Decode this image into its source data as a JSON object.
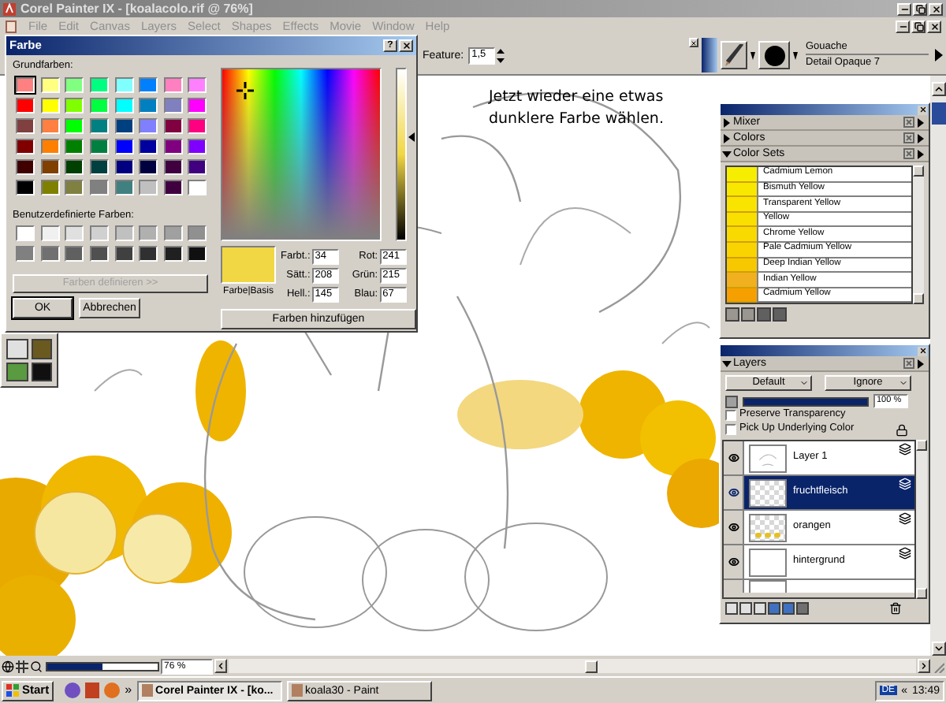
{
  "window": {
    "title": "Corel Painter IX - [koalacolo.rif @ 76%]"
  },
  "menu": [
    "File",
    "Edit",
    "Canvas",
    "Layers",
    "Select",
    "Shapes",
    "Effects",
    "Movie",
    "Window",
    "Help"
  ],
  "property_bar": {
    "feature_label": "Feature:",
    "feature_value": "1,5",
    "brush_category": "Gouache",
    "brush_variant": "Detail Opaque 7"
  },
  "canvas": {
    "caption": "Jetzt wieder eine etwas dunklere Farbe wählen."
  },
  "color_dialog": {
    "title": "Farbe",
    "help": "?",
    "basic_label": "Grundfarben:",
    "basic_colors": [
      {
        "color": "#ff8080",
        "selected": true
      },
      {
        "color": "#ffff80",
        "selected": false
      },
      {
        "color": "#80ff80",
        "selected": false
      },
      {
        "color": "#00ff80",
        "selected": false
      },
      {
        "color": "#80ffff",
        "selected": false
      },
      {
        "color": "#0080ff",
        "selected": false
      },
      {
        "color": "#ff80c0",
        "selected": false
      },
      {
        "color": "#ff80ff",
        "selected": false
      },
      {
        "color": "#ff0000",
        "selected": false
      },
      {
        "color": "#ffff00",
        "selected": false
      },
      {
        "color": "#80ff00",
        "selected": false
      },
      {
        "color": "#00ff40",
        "selected": false
      },
      {
        "color": "#00ffff",
        "selected": false
      },
      {
        "color": "#0080c0",
        "selected": false
      },
      {
        "color": "#8080c0",
        "selected": false
      },
      {
        "color": "#ff00ff",
        "selected": false
      },
      {
        "color": "#804040",
        "selected": false
      },
      {
        "color": "#ff8040",
        "selected": false
      },
      {
        "color": "#00ff00",
        "selected": false
      },
      {
        "color": "#008080",
        "selected": false
      },
      {
        "color": "#004080",
        "selected": false
      },
      {
        "color": "#8080ff",
        "selected": false
      },
      {
        "color": "#800040",
        "selected": false
      },
      {
        "color": "#ff0080",
        "selected": false
      },
      {
        "color": "#800000",
        "selected": false
      },
      {
        "color": "#ff8000",
        "selected": false
      },
      {
        "color": "#008000",
        "selected": false
      },
      {
        "color": "#008040",
        "selected": false
      },
      {
        "color": "#0000ff",
        "selected": false
      },
      {
        "color": "#0000a0",
        "selected": false
      },
      {
        "color": "#800080",
        "selected": false
      },
      {
        "color": "#8000ff",
        "selected": false
      },
      {
        "color": "#400000",
        "selected": false
      },
      {
        "color": "#804000",
        "selected": false
      },
      {
        "color": "#004000",
        "selected": false
      },
      {
        "color": "#004040",
        "selected": false
      },
      {
        "color": "#000080",
        "selected": false
      },
      {
        "color": "#000040",
        "selected": false
      },
      {
        "color": "#400040",
        "selected": false
      },
      {
        "color": "#400080",
        "selected": false
      },
      {
        "color": "#000000",
        "selected": false
      },
      {
        "color": "#808000",
        "selected": false
      },
      {
        "color": "#808040",
        "selected": false
      },
      {
        "color": "#808080",
        "selected": false
      },
      {
        "color": "#408080",
        "selected": false
      },
      {
        "color": "#c0c0c0",
        "selected": false
      },
      {
        "color": "#400040",
        "selected": false
      },
      {
        "color": "#ffffff",
        "selected": false
      }
    ],
    "custom_label": "Benutzerdefinierte Farben:",
    "custom_colors": [
      {
        "color": "#ffffff"
      },
      {
        "color": "#f0f0f0"
      },
      {
        "color": "#e0e0e0"
      },
      {
        "color": "#d0d0d0"
      },
      {
        "color": "#c0c0c0"
      },
      {
        "color": "#b0b0b0"
      },
      {
        "color": "#a0a0a0"
      },
      {
        "color": "#909090"
      },
      {
        "color": "#808080"
      },
      {
        "color": "#707070"
      },
      {
        "color": "#606060"
      },
      {
        "color": "#505050"
      },
      {
        "color": "#404040"
      },
      {
        "color": "#303030"
      },
      {
        "color": "#202020"
      },
      {
        "color": "#101010"
      }
    ],
    "define_button": {
      "label": "Farben definieren >>",
      "disabled": true
    },
    "ok": "OK",
    "cancel": "Abbrechen",
    "preview_label": "Farbe|Basis",
    "lightness": {
      "level": 0.6
    },
    "fields": [
      {
        "label": "Farbt.:",
        "value": "34"
      },
      {
        "label": "Rot:",
        "value": "241"
      },
      {
        "label": "Sätt.:",
        "value": "208"
      },
      {
        "label": "Grün:",
        "value": "215"
      },
      {
        "label": "Hell.:",
        "value": "145"
      },
      {
        "label": "Blau:",
        "value": "67"
      }
    ],
    "add_button": "Farben hinzufügen"
  },
  "color_palette": {
    "sections": [
      {
        "label": "Mixer",
        "expanded": false
      },
      {
        "label": "Colors",
        "expanded": false
      },
      {
        "label": "Color Sets",
        "expanded": true
      }
    ],
    "color_sets": [
      {
        "name": "Cadmium Lemon",
        "color": "#f6ee00"
      },
      {
        "name": "Bismuth Yellow",
        "color": "#f8e800"
      },
      {
        "name": "Transparent Yellow",
        "color": "#f9e400"
      },
      {
        "name": "Yellow",
        "color": "#f9e000"
      },
      {
        "name": "Chrome Yellow",
        "color": "#f9da00"
      },
      {
        "name": "Pale Cadmium Yellow",
        "color": "#f9d400"
      },
      {
        "name": "Deep Indian Yellow",
        "color": "#f7c800"
      },
      {
        "name": "Indian Yellow",
        "color": "#f0b020"
      },
      {
        "name": "Cadmium Yellow",
        "color": "#f5a000"
      }
    ]
  },
  "layers_panel": {
    "title": "Layers",
    "expanded": true,
    "method": "Default",
    "depth": "Ignore",
    "opacity": {
      "level": 1,
      "reading": "100 %"
    },
    "options": [
      {
        "label": "Preserve Transparency",
        "checked": false
      },
      {
        "label": "Pick Up Underlying Color",
        "checked": false
      }
    ],
    "layers": [
      {
        "name": "Layer 1",
        "kind": "sketch",
        "visible": true,
        "selected": false
      },
      {
        "name": "fruchtfleisch",
        "kind": "transparent",
        "visible": true,
        "selected": true
      },
      {
        "name": "orangen",
        "kind": "fruit",
        "visible": true,
        "selected": false
      },
      {
        "name": "hintergrund",
        "kind": "plain",
        "visible": true,
        "selected": false
      }
    ]
  },
  "status_bar": {
    "zoom": {
      "level": 0.5,
      "reading": "76 %"
    }
  },
  "taskbar": {
    "start": "Start",
    "more": "»",
    "tasks": [
      {
        "label": "Corel Painter IX - [ko...",
        "selected": true
      },
      {
        "label": "koala30 - Paint",
        "selected": false
      }
    ],
    "language": "DE",
    "tray_toggle": "«",
    "clock": "13:49"
  }
}
